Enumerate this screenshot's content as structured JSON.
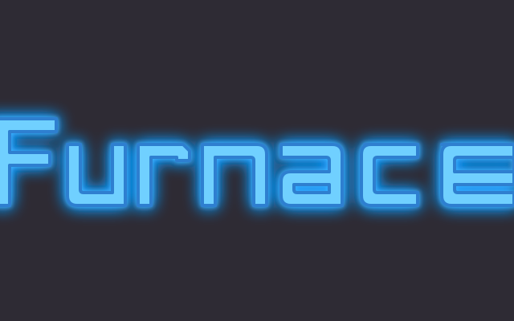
{
  "logo": {
    "text": "Furnace"
  },
  "colors": {
    "background": "#2e2b34",
    "glow": "#1a9bff",
    "fill": "#6fd0ff",
    "stroke": "#2f7fd0"
  }
}
